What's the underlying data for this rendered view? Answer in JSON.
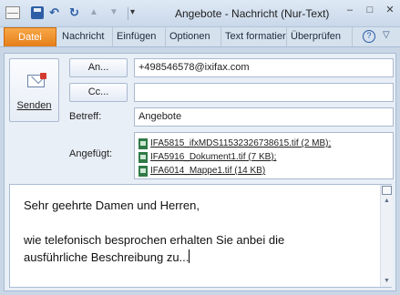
{
  "window": {
    "title": "Angebote - Nachricht (Nur-Text)",
    "controls": {
      "minimize": "–",
      "maximize": "□",
      "close": "✕"
    }
  },
  "quick_access": {
    "save_icon": "save-icon",
    "undo_icon": "undo-icon",
    "redo_icon": "redo-icon",
    "previous_icon": "up-arrow-icon",
    "next_icon": "down-arrow-icon",
    "customize_icon": "customize-dropdown-icon",
    "undo_glyph": "↶",
    "redo_glyph": "↻",
    "up_glyph": "▲",
    "down_glyph": "▼",
    "customize_glyph": "▾"
  },
  "ribbon": {
    "file_tab": "Datei",
    "tabs": [
      "Nachricht",
      "Einfügen",
      "Optionen",
      "Text formatieren",
      "Überprüfen"
    ],
    "help_glyph": "?",
    "collapse_glyph": "▽",
    "accent_color": "#e57e1a"
  },
  "compose": {
    "send_label": "Senden",
    "to_button": "An...",
    "cc_button": "Cc...",
    "subject_label": "Betreff:",
    "attached_label": "Angefügt:",
    "to_value": "+498546578@ixifax.com",
    "cc_value": "",
    "subject_value": "Angebote",
    "attachments": [
      "IFA5815_ifxMDS11532326738615.tif (2 MB);",
      "IFA5916_Dokument1.tif (7 KB);",
      "IFA6014_Mappe1.tif (14 KB)"
    ]
  },
  "body": {
    "lines": [
      "Sehr geehrte Damen und Herren,",
      "",
      "wie telefonisch besprochen erhalten Sie anbei die",
      "ausführliche Beschreibung zu..."
    ]
  }
}
